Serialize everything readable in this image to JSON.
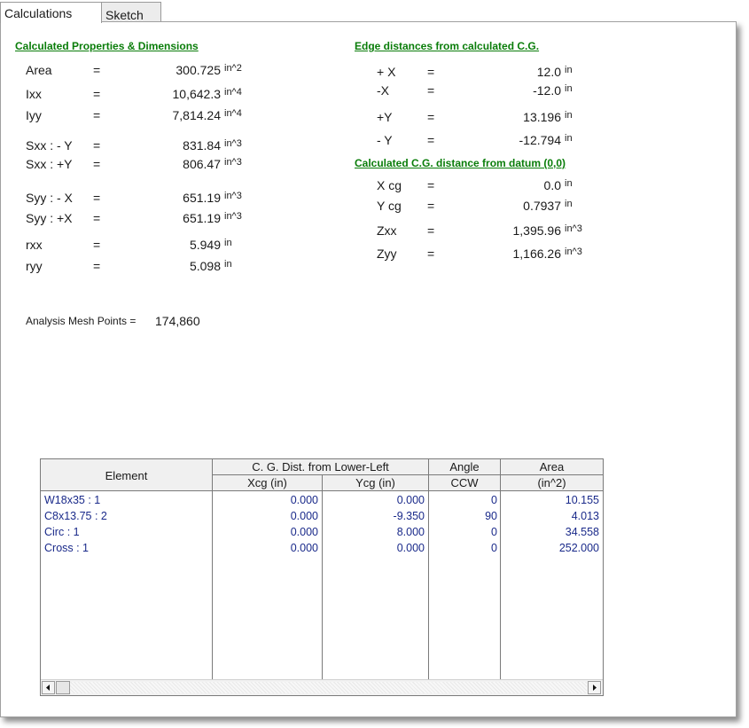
{
  "tabs": {
    "calculations": "Calculations",
    "sketch": "Sketch"
  },
  "left": {
    "heading": "Calculated Properties & Dimensions",
    "rows": [
      {
        "label": "Area",
        "eq": "=",
        "value": "300.725",
        "unit": "in^2"
      },
      {
        "label": "Ixx",
        "eq": "=",
        "value": "10,642.3",
        "unit": "in^4"
      },
      {
        "label": "Iyy",
        "eq": "=",
        "value": "7,814.24",
        "unit": "in^4"
      },
      {
        "label": "Sxx : - Y",
        "eq": "=",
        "value": "831.84",
        "unit": "in^3"
      },
      {
        "label": "Sxx : +Y",
        "eq": "=",
        "value": "806.47",
        "unit": "in^3"
      },
      {
        "label": "Syy : - X",
        "eq": "=",
        "value": "651.19",
        "unit": "in^3"
      },
      {
        "label": "Syy : +X",
        "eq": "=",
        "value": "651.19",
        "unit": "in^3"
      },
      {
        "label": "rxx",
        "eq": "=",
        "value": "5.949",
        "unit": "in"
      },
      {
        "label": "ryy",
        "eq": "=",
        "value": "5.098",
        "unit": "in"
      }
    ],
    "mesh_label": "Analysis Mesh Points =",
    "mesh_value": "174,860"
  },
  "right": {
    "heading1": "Edge distances from calculated C.G.",
    "edge_rows": [
      {
        "label": "+ X",
        "eq": "=",
        "value": "12.0",
        "unit": "in"
      },
      {
        "label": "-X",
        "eq": "=",
        "value": "-12.0",
        "unit": "in"
      },
      {
        "label": "+Y",
        "eq": "=",
        "value": "13.196",
        "unit": "in"
      },
      {
        "label": "- Y",
        "eq": "=",
        "value": "-12.794",
        "unit": "in"
      }
    ],
    "heading2": "Calculated C.G. distance from datum  (0,0)",
    "cg_rows": [
      {
        "label": "X cg",
        "eq": "=",
        "value": "0.0",
        "unit": "in"
      },
      {
        "label": "Y cg",
        "eq": "=",
        "value": "0.7937",
        "unit": "in"
      },
      {
        "label": "Zxx",
        "eq": "=",
        "value": "1,395.96",
        "unit": "in^3"
      },
      {
        "label": "Zyy",
        "eq": "=",
        "value": "1,166.26",
        "unit": "in^3"
      }
    ]
  },
  "table": {
    "headers": {
      "element": "Element",
      "cg_group": "C. G. Dist. from Lower-Left",
      "xcg": "Xcg  (in)",
      "ycg": "Ycg  (in)",
      "angle": "Angle",
      "angle_sub": "CCW",
      "area": "Area",
      "area_sub": "(in^2)"
    },
    "rows": [
      {
        "element": "W18x35 : 1",
        "xcg": "0.000",
        "ycg": "0.000",
        "angle": "0",
        "area": "10.155"
      },
      {
        "element": "C8x13.75 : 2",
        "xcg": "0.000",
        "ycg": "-9.350",
        "angle": "90",
        "area": "4.013"
      },
      {
        "element": "Circ : 1",
        "xcg": "0.000",
        "ycg": "8.000",
        "angle": "0",
        "area": "34.558"
      },
      {
        "element": "Cross : 1",
        "xcg": "0.000",
        "ycg": "0.000",
        "angle": "0",
        "area": "252.000"
      }
    ]
  }
}
